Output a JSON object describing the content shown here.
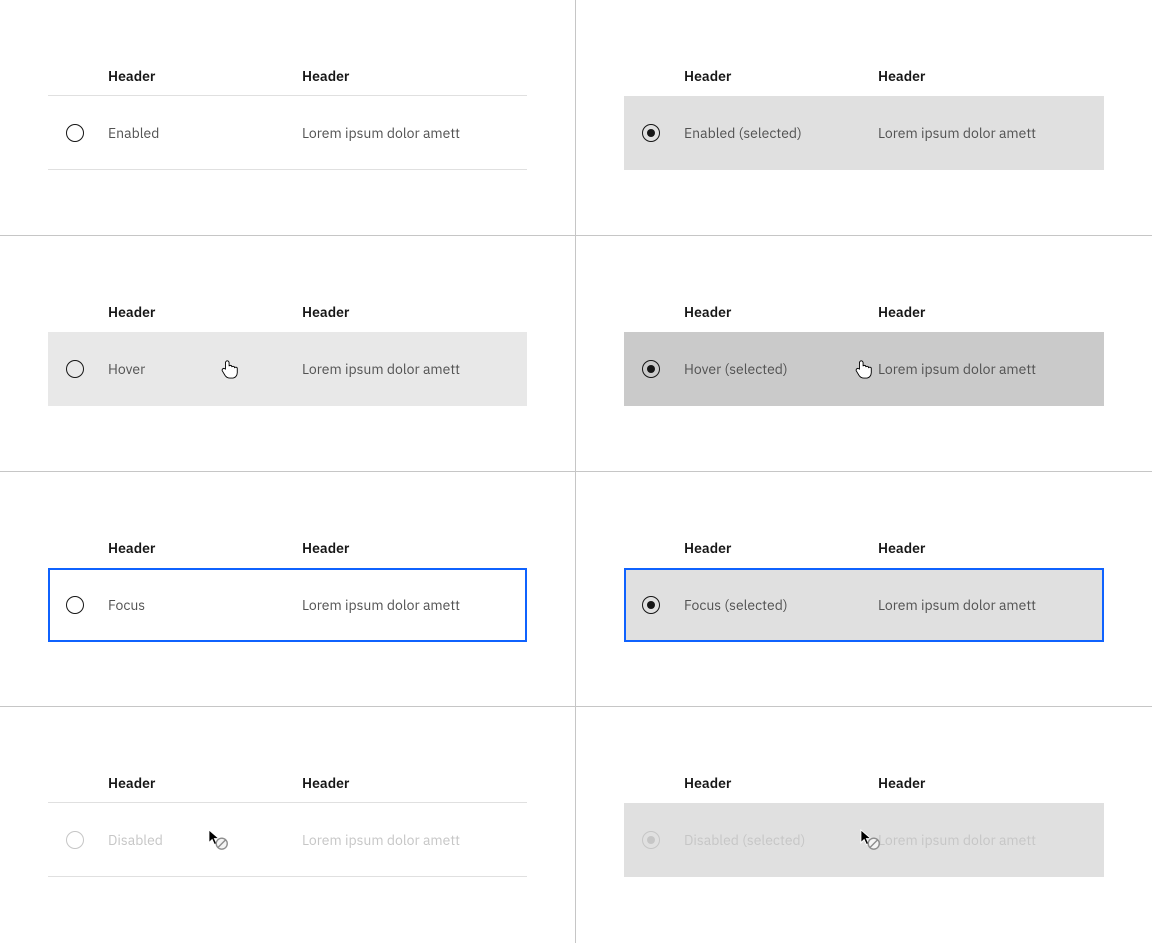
{
  "colors": {
    "focus_outline": "#0f62fe",
    "selected_bg": "#e0e0e0",
    "hover_bg": "#e8e8e8",
    "hover_selected_bg": "#cacaca",
    "disabled": "#c6c6c6",
    "text_primary": "#161616",
    "text_secondary": "#525252"
  },
  "states": [
    {
      "id": "enabled",
      "headers": [
        "Header",
        "Header"
      ],
      "label": "Enabled",
      "description": "Lorem ipsum dolor amett",
      "selected": false,
      "hover": false,
      "focus": false,
      "disabled": false
    },
    {
      "id": "enabled-selected",
      "headers": [
        "Header",
        "Header"
      ],
      "label": "Enabled (selected)",
      "description": "Lorem ipsum dolor amett",
      "selected": true,
      "hover": false,
      "focus": false,
      "disabled": false
    },
    {
      "id": "hover",
      "headers": [
        "Header",
        "Header"
      ],
      "label": "Hover",
      "description": "Lorem ipsum dolor amett",
      "selected": false,
      "hover": true,
      "focus": false,
      "disabled": false,
      "cursor": "hand"
    },
    {
      "id": "hover-selected",
      "headers": [
        "Header",
        "Header"
      ],
      "label": "Hover (selected)",
      "description": "Lorem ipsum dolor amett",
      "selected": true,
      "hover": true,
      "focus": false,
      "disabled": false,
      "cursor": "hand"
    },
    {
      "id": "focus",
      "headers": [
        "Header",
        "Header"
      ],
      "label": "Focus",
      "description": "Lorem ipsum dolor amett",
      "selected": false,
      "hover": false,
      "focus": true,
      "disabled": false
    },
    {
      "id": "focus-selected",
      "headers": [
        "Header",
        "Header"
      ],
      "label": "Focus (selected)",
      "description": "Lorem ipsum dolor amett",
      "selected": true,
      "hover": false,
      "focus": true,
      "disabled": false
    },
    {
      "id": "disabled",
      "headers": [
        "Header",
        "Header"
      ],
      "label": "Disabled",
      "description": "Lorem ipsum dolor amett",
      "selected": false,
      "hover": false,
      "focus": false,
      "disabled": true,
      "cursor": "not-allowed"
    },
    {
      "id": "disabled-selected",
      "headers": [
        "Header",
        "Header"
      ],
      "label": "Disabled (selected)",
      "description": "Lorem ipsum dolor amett",
      "selected": true,
      "hover": false,
      "focus": false,
      "disabled": true,
      "cursor": "not-allowed"
    }
  ]
}
